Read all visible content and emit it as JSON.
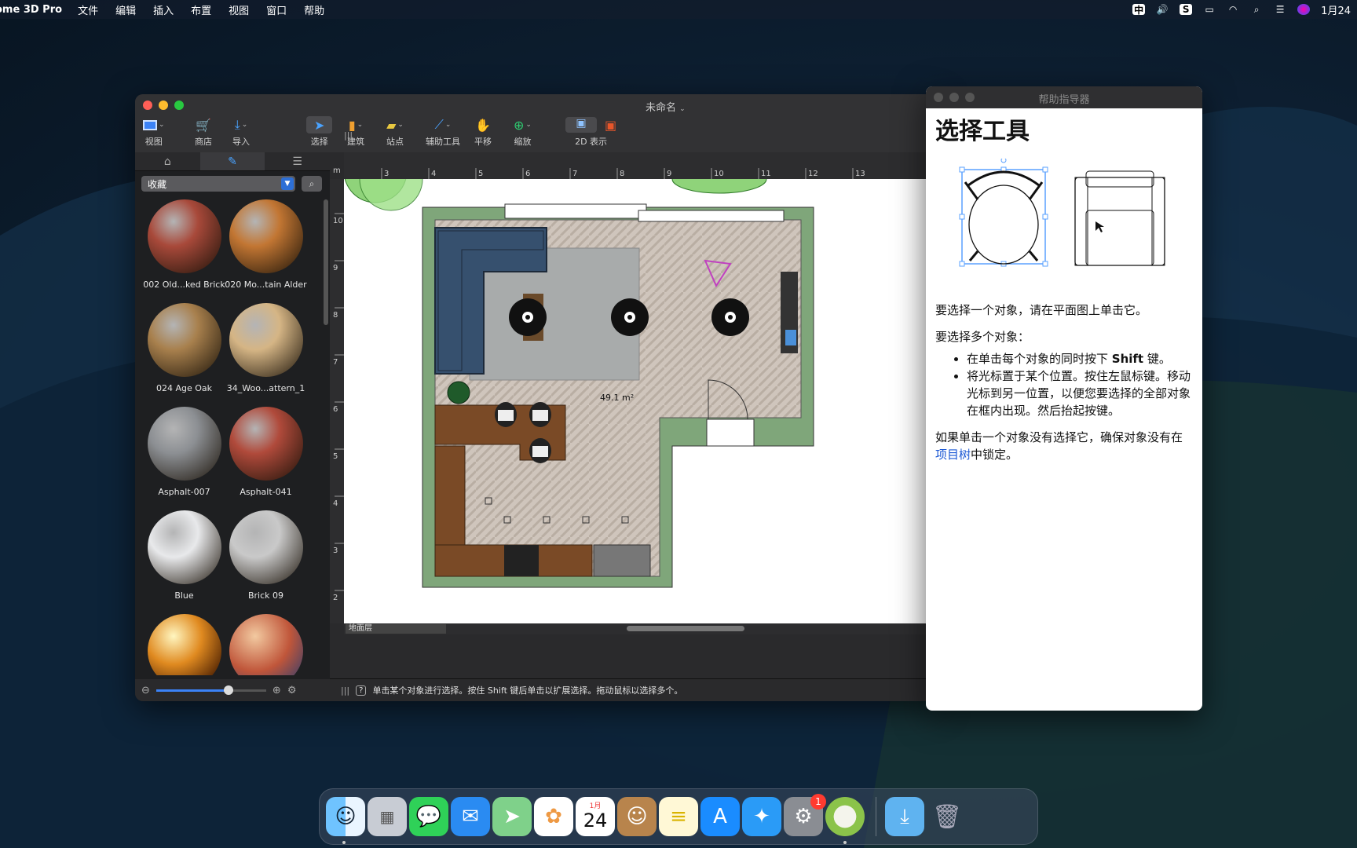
{
  "menubar": {
    "app_name": "ome 3D Pro",
    "items": [
      "文件",
      "编辑",
      "插入",
      "布置",
      "视图",
      "窗口",
      "帮助"
    ],
    "ime": "中",
    "clock": "1月24"
  },
  "window": {
    "title": "未命名",
    "toolbar": [
      {
        "label": "视图"
      },
      {
        "label": "商店"
      },
      {
        "label": "导入"
      },
      {
        "label": "选择"
      },
      {
        "label": "建筑"
      },
      {
        "label": "站点"
      },
      {
        "label": "辅助工具"
      },
      {
        "label": "平移"
      },
      {
        "label": "缩放"
      },
      {
        "label": "2D 表示"
      }
    ]
  },
  "library": {
    "collection": "收藏",
    "materials": [
      {
        "name": "002 Old...ked Brick",
        "color": "#a8493a"
      },
      {
        "name": "020 Mo...tain Alder",
        "color": "#c27633"
      },
      {
        "name": "024 Age Oak",
        "color": "#a8804d"
      },
      {
        "name": "34_Woo...attern_1",
        "color": "#d5b585"
      },
      {
        "name": "Asphalt-007",
        "color": "#8c8f93"
      },
      {
        "name": "Asphalt-041",
        "color": "#b04a3b"
      },
      {
        "name": "Blue",
        "color": "#e8e9eb"
      },
      {
        "name": "Brick 09",
        "color": "#c9c9c9"
      }
    ]
  },
  "plan": {
    "ruler_unit": "m",
    "ruler_top": [
      "3",
      "4",
      "5",
      "6",
      "7",
      "8",
      "9",
      "10",
      "11",
      "12",
      "13"
    ],
    "ruler_left": [
      "10",
      "9",
      "8",
      "7",
      "6",
      "5",
      "4",
      "3",
      "2"
    ],
    "area_label": "49.1 m²",
    "level": "地面层",
    "status": "单击某个对象进行选择。按住 Shift 键后单击以扩展选择。拖动鼠标以选择多个。"
  },
  "help": {
    "window_title": "帮助指导器",
    "heading": "选择工具",
    "p1": "要选择一个对象，请在平面图上单击它。",
    "p2": "要选择多个对象：",
    "bullet1_pre": "在单击每个对象的同时按下 ",
    "bullet1_bold": "Shift",
    "bullet1_post": " 键。",
    "bullet2": "将光标置于某个位置。按住左鼠标键。移动光标到另一位置，以便您要选择的全部对象在框内出现。然后抬起按键。",
    "p3_pre": "如果单击一个对象没有选择它，确保对象没有在",
    "p3_link": "项目树",
    "p3_post": "中锁定。"
  },
  "dock": {
    "calendar_month": "1月",
    "calendar_day": "24",
    "settings_badge": "1"
  }
}
